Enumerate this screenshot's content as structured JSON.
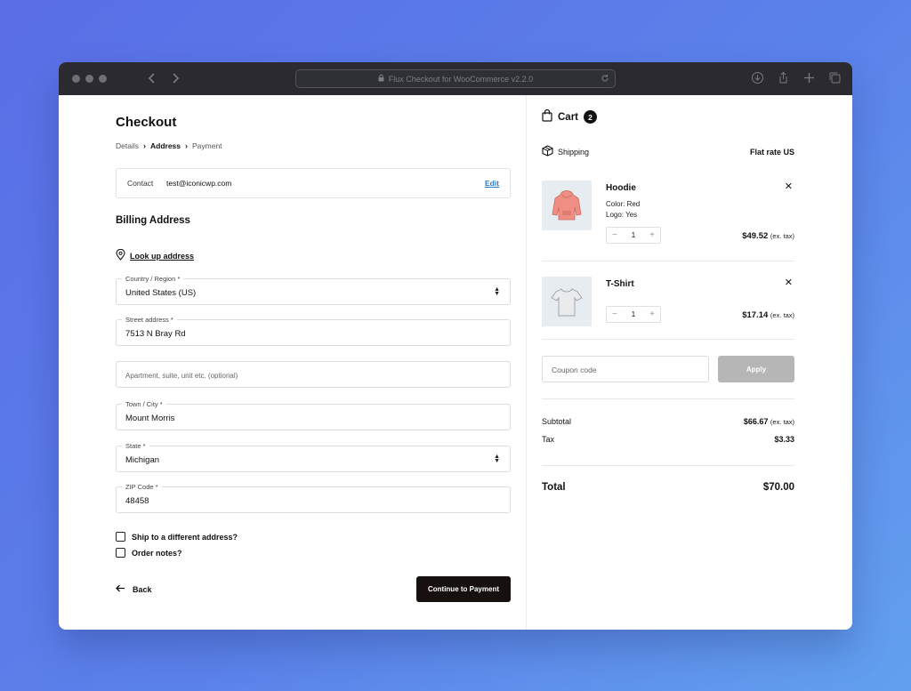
{
  "browser": {
    "url_title": "Flux Checkout for WooCommerce v2.2.0"
  },
  "checkout": {
    "title": "Checkout",
    "breadcrumbs": [
      "Details",
      "Address",
      "Payment"
    ],
    "contact": {
      "label": "Contact",
      "value": "test@iconicwp.com",
      "edit": "Edit"
    },
    "billing_title": "Billing Address",
    "lookup": "Look up address",
    "fields": {
      "country": {
        "label": "Country / Region *",
        "value": "United States (US)"
      },
      "street": {
        "label": "Street address *",
        "value": "7513 N Bray Rd"
      },
      "apartment": {
        "placeholder": "Apartment, suite, unit etc. (optional)"
      },
      "city": {
        "label": "Town / City *",
        "value": "Mount Morris"
      },
      "state": {
        "label": "State *",
        "value": "Michigan"
      },
      "zip": {
        "label": "ZIP Code *",
        "value": "48458"
      }
    },
    "ship_different": "Ship to a different address?",
    "order_notes": "Order notes?",
    "back": "Back",
    "continue": "Continue to Payment"
  },
  "cart": {
    "title": "Cart",
    "count": "2",
    "shipping_label": "Shipping",
    "shipping_value": "Flat rate US",
    "items": [
      {
        "name": "Hoodie",
        "meta1": "Color: Red",
        "meta2": "Logo: Yes",
        "qty": "1",
        "price": "$49.52",
        "tax": "(ex. tax)"
      },
      {
        "name": "T-Shirt",
        "qty": "1",
        "price": "$17.14",
        "tax": "(ex. tax)"
      }
    ],
    "coupon_placeholder": "Coupon code",
    "apply": "Apply",
    "subtotal_label": "Subtotal",
    "subtotal_value": "$66.67",
    "subtotal_tax": "(ex. tax)",
    "tax_label": "Tax",
    "tax_value": "$3.33",
    "total_label": "Total",
    "total_value": "$70.00"
  }
}
